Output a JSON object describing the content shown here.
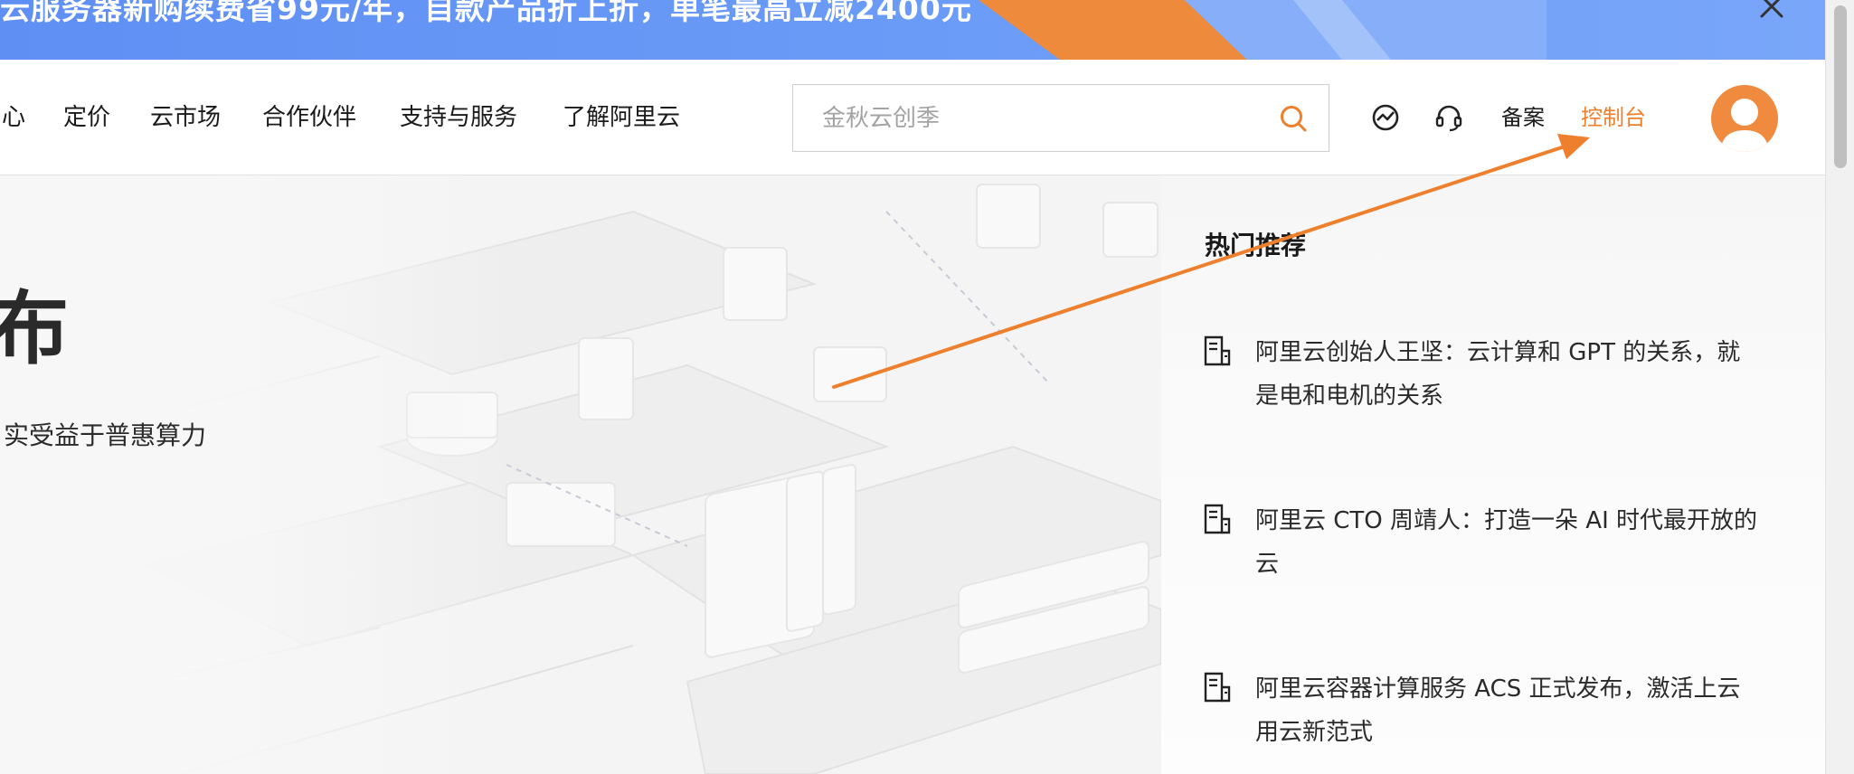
{
  "promo": {
    "text": "云服务器新购续费省99元/年，自款产品折上折，单笔最高立减2400元",
    "close_icon": "close-icon"
  },
  "nav": {
    "items": [
      "心",
      "定价",
      "云市场",
      "合作伙伴",
      "支持与服务",
      "了解阿里云"
    ],
    "search_placeholder": "金秋云创季",
    "icons": [
      "ai-assistant-icon",
      "headset-icon"
    ],
    "beian": "备案",
    "console": "控制台"
  },
  "hero": {
    "title": "布",
    "subtitle": "实受益于普惠算力"
  },
  "panel": {
    "title": "热门推荐",
    "news": [
      "阿里云创始人王坚：云计算和 GPT 的关系，就是电和电机的关系",
      "阿里云 CTO 周靖人：打造一朵 AI 时代最开放的云",
      "阿里云容器计算服务 ACS 正式发布，激活上云用云新范式"
    ]
  },
  "colors": {
    "accent": "#ee7f2d",
    "promo_blue": "#6a9bf7",
    "text": "#1a1a1a"
  }
}
